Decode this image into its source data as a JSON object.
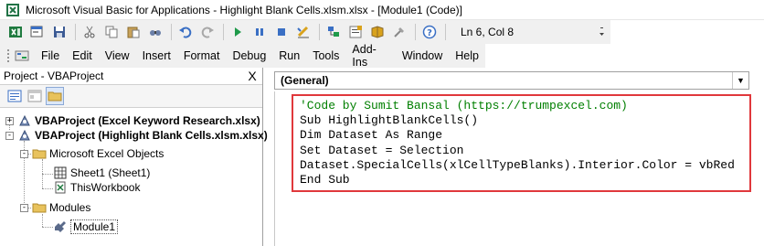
{
  "window": {
    "title": "Microsoft Visual Basic for Applications - Highlight Blank Cells.xlsm.xlsx - [Module1 (Code)]"
  },
  "toolbar": {
    "status": "Ln 6, Col 8",
    "icons": [
      "excel-icon",
      "insert-userform-icon",
      "save-icon",
      "cut-icon",
      "copy-icon",
      "paste-icon",
      "find-icon",
      "undo-icon",
      "redo-icon",
      "run-icon",
      "break-icon",
      "reset-icon",
      "design-mode-icon",
      "project-explorer-icon",
      "properties-icon",
      "object-browser-icon",
      "toolbox-icon",
      "help-icon"
    ]
  },
  "menu": {
    "items": [
      "File",
      "Edit",
      "View",
      "Insert",
      "Format",
      "Debug",
      "Run",
      "Tools",
      "Add-Ins",
      "Window",
      "Help"
    ]
  },
  "project_pane": {
    "title": "Project - VBAProject",
    "close": "X",
    "tree": [
      {
        "label": "VBAProject (Excel Keyword Research.xlsx)",
        "expander": "+"
      },
      {
        "label": "VBAProject (Highlight Blank Cells.xlsm.xlsx)",
        "expander": "-"
      },
      {
        "label": "Microsoft Excel Objects",
        "expander": "-"
      },
      {
        "label": "Sheet1 (Sheet1)"
      },
      {
        "label": "ThisWorkbook"
      },
      {
        "label": "Modules",
        "expander": "-"
      },
      {
        "label": "Module1"
      }
    ]
  },
  "code_pane": {
    "object_combo": "(General)",
    "lines": [
      "'Code by Sumit Bansal (https://trumpexcel.com)",
      "Sub HighlightBlankCells()",
      "Dim Dataset As Range",
      "Set Dataset = Selection",
      "Dataset.SpecialCells(xlCellTypeBlanks).Interior.Color = vbRed",
      "End Sub"
    ],
    "highlight_color": "#e0383c"
  }
}
